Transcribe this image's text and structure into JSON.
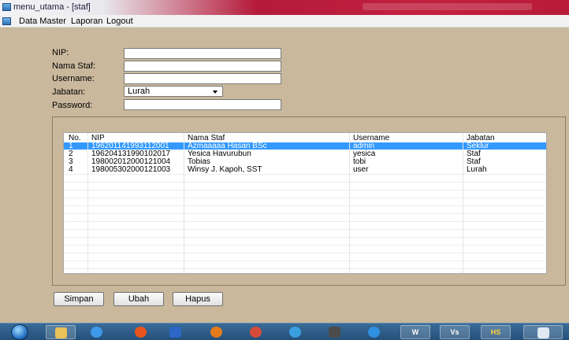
{
  "window": {
    "title": "menu_utama - [staf]"
  },
  "menubar": {
    "items": [
      {
        "label": "Data Master"
      },
      {
        "label": "Laporan"
      },
      {
        "label": "Logout"
      }
    ]
  },
  "form": {
    "nip_label": "NIP:",
    "nip_value": "",
    "nama_label": "Nama Staf:",
    "nama_value": "",
    "username_label": "Username:",
    "username_value": "",
    "jabatan_label": "Jabatan:",
    "jabatan_selected": "Lurah",
    "password_label": "Password:",
    "password_value": ""
  },
  "grid": {
    "columns": [
      "No.",
      "NIP",
      "Nama Staf",
      "Username",
      "Jabatan"
    ],
    "rows": [
      {
        "no": "1",
        "nip": "196201141993112001",
        "nama": "Azmaaaaa Hasan BSc",
        "username": "admin",
        "jabatan": "Seklur",
        "selected": true
      },
      {
        "no": "2",
        "nip": "196204131990102017",
        "nama": "Yesica Havurubun",
        "username": "yesica",
        "jabatan": "Staf",
        "selected": false
      },
      {
        "no": "3",
        "nip": "198002012000121004",
        "nama": "Tobias",
        "username": "tobi",
        "jabatan": "Staf",
        "selected": false
      },
      {
        "no": "4",
        "nip": "198005302000121003",
        "nama": "Winsy J. Kapoh, SST",
        "username": "user",
        "jabatan": "Lurah",
        "selected": false
      }
    ]
  },
  "buttons": {
    "simpan": "Simpan",
    "ubah": "Ubah",
    "hapus": "Hapus"
  },
  "taskbar": {
    "word_label": "W",
    "vb_label": "Vs",
    "hs_label": "HS"
  }
}
